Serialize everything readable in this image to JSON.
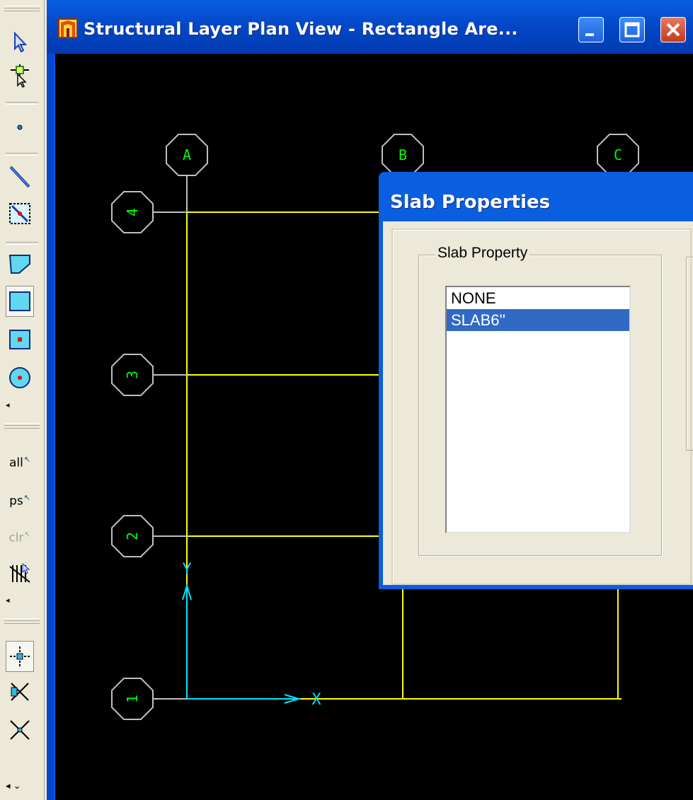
{
  "window": {
    "title": "Structural Layer  Plan View - Rectangle Are...",
    "minimize_icon": "minimize-icon",
    "maximize_icon": "maximize-icon",
    "close_icon": "close-icon"
  },
  "toolbar": {
    "tools": [
      {
        "name": "pointer-select-icon"
      },
      {
        "name": "reshape-pointer-icon"
      },
      {
        "name": "draw-point-icon"
      },
      {
        "name": "draw-line-icon"
      },
      {
        "name": "draw-line-in-region-icon"
      },
      {
        "name": "draw-polygon-area-icon"
      },
      {
        "name": "draw-rectangle-area-icon"
      },
      {
        "name": "draw-area-in-region-icon"
      },
      {
        "name": "draw-circle-area-icon"
      }
    ],
    "select_all": "all",
    "select_previous": "ps",
    "clear_selection": "clr",
    "chevron": "◂",
    "chevron_more": "◂ ⌄"
  },
  "plan": {
    "grid_columns": [
      "A",
      "B",
      "C"
    ],
    "grid_rows": [
      "4",
      "3",
      "2",
      "1"
    ],
    "axis_y": "Y",
    "axis_x": "X",
    "colors": {
      "background": "#000000",
      "grid_line": "#ffff00",
      "bubble": "#00ff00",
      "axis": "#00ffff"
    }
  },
  "dialog": {
    "title": "Slab Properties",
    "group_label": "Slab Property",
    "list_items": [
      "NONE",
      "SLAB6''"
    ],
    "selected_index": 1
  }
}
